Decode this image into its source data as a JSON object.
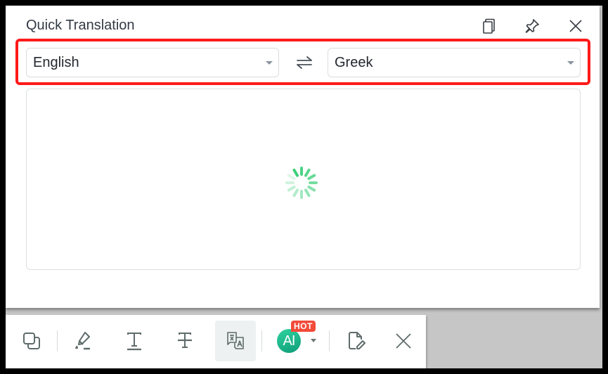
{
  "panel": {
    "title": "Quick Translation",
    "header_buttons": [
      {
        "name": "copy",
        "icon": "copy-icon"
      },
      {
        "name": "pin",
        "icon": "pin-icon"
      },
      {
        "name": "close",
        "icon": "close-icon"
      }
    ]
  },
  "languages": {
    "source": "English",
    "target": "Greek",
    "swap_icon": "swap-arrows-icon"
  },
  "result": {
    "state": "loading",
    "spinner_color": "#2ecc71"
  },
  "toolbar": {
    "items": [
      {
        "name": "copy",
        "icon": "copy-icon"
      },
      {
        "name": "highlight",
        "icon": "highlighter-icon"
      },
      {
        "name": "underline",
        "icon": "underline-text-icon"
      },
      {
        "name": "strikethrough",
        "icon": "strikethrough-text-icon"
      },
      {
        "name": "translate",
        "icon": "translate-icon",
        "active": true
      },
      {
        "name": "ai",
        "icon": "ai-icon",
        "label": "AI",
        "badge": "HOT"
      },
      {
        "name": "note",
        "icon": "note-edit-icon"
      },
      {
        "name": "close",
        "icon": "close-icon"
      }
    ],
    "ai_label": "AI",
    "ai_badge": "HOT"
  },
  "colors": {
    "highlight_border": "#ff1a1a",
    "accent_green": "#1fb98a",
    "badge_red": "#f24b3a",
    "icon_gray": "#5f6b6b"
  }
}
